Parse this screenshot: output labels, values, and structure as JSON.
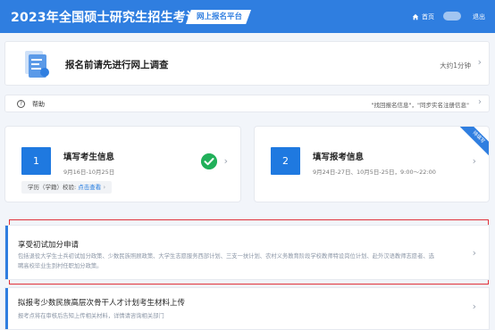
{
  "header": {
    "title": "2023年全国硕士研究生招生考试",
    "platform_badge": "网上报名平台",
    "home_label": "首页",
    "logout_label": "退出"
  },
  "survey": {
    "title": "报名前请先进行网上调查",
    "duration": "大约1分钟"
  },
  "help": {
    "label": "帮助",
    "tips": "\"找回报名信息\"，\"同步实名注册信息\""
  },
  "steps": [
    {
      "number": "1",
      "title": "填写考生信息",
      "date": "9月16日-10月25日",
      "sub_label": "学历（学籍）校验:",
      "sub_link": "点击查看",
      "completed": true
    },
    {
      "number": "2",
      "title": "填写报考信息",
      "date": "9月24日-27日、10月5日-25日，9:00～22:00",
      "ribbon": "待填写"
    }
  ],
  "list_items": {
    "bonus": {
      "title": "享受初试加分申请",
      "description": "包括退役大学生士兵初试加分政策、少数民族照顾政策、大学生志愿服务西部计划、三支一扶计划、农村义务教育阶段学校教师特设岗位计划、赴外汉语教师志愿者、选聘高校毕业生到村任职加分政策。"
    },
    "minority": {
      "title": "拟报考少数民族高层次骨干人才计划考生材料上传",
      "description": "报考点将在审核后告知上传相关材料，详情请咨询相关部门"
    }
  },
  "colors": {
    "brand_blue": "#2f7ee0",
    "check_green": "#21b05a",
    "highlight_red": "#e0313a"
  },
  "icons": {
    "home": "home-icon",
    "survey": "survey-document-icon",
    "help": "help-circle-icon",
    "check": "check-circle-icon",
    "chevron": "chevron-right-icon"
  }
}
